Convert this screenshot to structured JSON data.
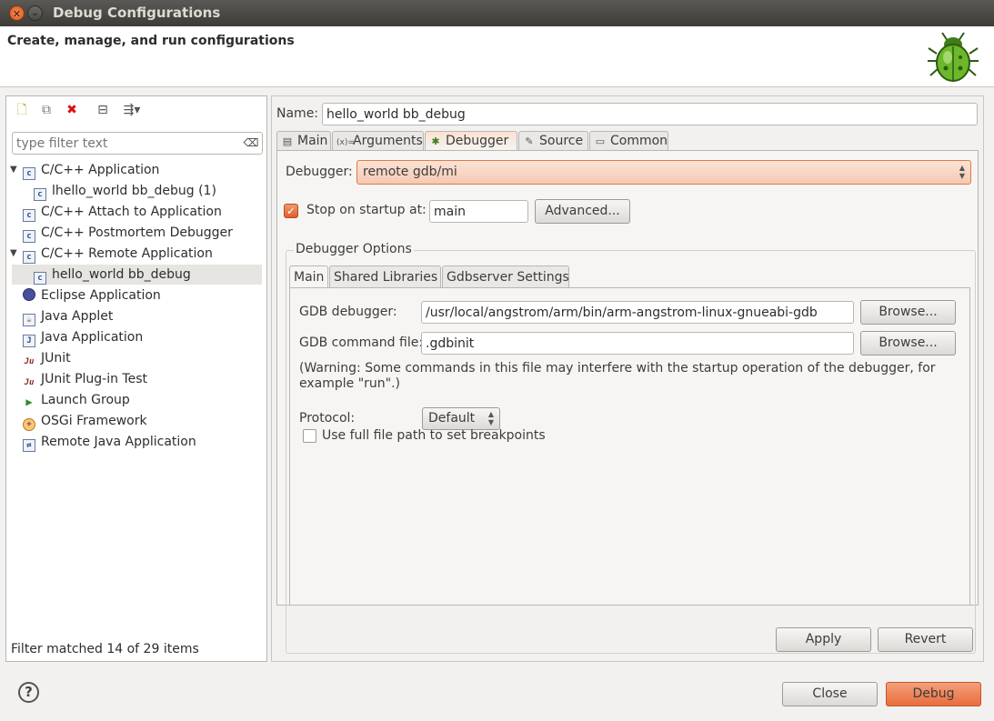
{
  "window": {
    "title": "Debug Configurations"
  },
  "banner": {
    "title": "Create, manage, and run configurations",
    "icon": "bug-icon"
  },
  "left": {
    "toolbar": [
      "new-configuration-icon",
      "duplicate-icon",
      "delete-icon",
      "collapse-all-icon",
      "filter-icon"
    ],
    "filter_placeholder": "type filter text",
    "tree": [
      {
        "label": "C/C++ Application",
        "icon": "c-config-icon",
        "expanded": true
      },
      {
        "label": "lhello_world bb_debug (1)",
        "icon": "c-config-icon",
        "child": true
      },
      {
        "label": "C/C++ Attach to Application",
        "icon": "c-config-icon"
      },
      {
        "label": "C/C++ Postmortem Debugger",
        "icon": "c-config-icon"
      },
      {
        "label": "C/C++ Remote Application",
        "icon": "c-config-icon",
        "expanded": true
      },
      {
        "label": "hello_world bb_debug",
        "icon": "c-config-icon",
        "child": true,
        "selected": true
      },
      {
        "label": "Eclipse Application",
        "icon": "eclipse-icon"
      },
      {
        "label": "Java Applet",
        "icon": "java-applet-icon"
      },
      {
        "label": "Java Application",
        "icon": "java-app-icon"
      },
      {
        "label": "JUnit",
        "icon": "junit-icon"
      },
      {
        "label": "JUnit Plug-in Test",
        "icon": "junit-plugin-icon"
      },
      {
        "label": "Launch Group",
        "icon": "launch-group-icon"
      },
      {
        "label": "OSGi Framework",
        "icon": "osgi-icon"
      },
      {
        "label": "Remote Java Application",
        "icon": "remote-java-icon"
      }
    ],
    "status": "Filter matched 14 of 29 items"
  },
  "config": {
    "name_label": "Name:",
    "name_value": "hello_world bb_debug",
    "tabs": [
      "Main",
      "Arguments",
      "Debugger",
      "Source",
      "Common"
    ],
    "tab_icons": [
      "main-tab-icon",
      "arguments-tab-icon",
      "debugger-tab-icon",
      "source-tab-icon",
      "common-tab-icon"
    ],
    "active_tab": "Debugger",
    "debugger_label": "Debugger:",
    "debugger_value": "remote gdb/mi",
    "stop_label": "Stop on startup at:",
    "stop_checked": true,
    "stop_value": "main",
    "advanced_button": "Advanced...",
    "options_legend": "Debugger Options",
    "inner_tabs": [
      "Main",
      "Shared Libraries",
      "Gdbserver Settings"
    ],
    "gdb_label": "GDB debugger:",
    "gdb_value": "/usr/local/angstrom/arm/bin/arm-angstrom-linux-gnueabi-gdb",
    "browse_label": "Browse...",
    "cmdfile_label": "GDB command file:",
    "cmdfile_value": ".gdbinit",
    "warning_line1": "(Warning: Some commands in this file may interfere with the startup operation of the debugger, for",
    "warning_line2": "example \"run\".)",
    "protocol_label": "Protocol:",
    "protocol_value": "Default",
    "fullpath_label": "Use full file path to set breakpoints",
    "fullpath_checked": false,
    "apply_button": "Apply",
    "revert_button": "Revert"
  },
  "footer": {
    "close_button": "Close",
    "debug_button": "Debug"
  },
  "colors": {
    "accent": "#e86d3d",
    "titlebar": "#3d3c38"
  }
}
